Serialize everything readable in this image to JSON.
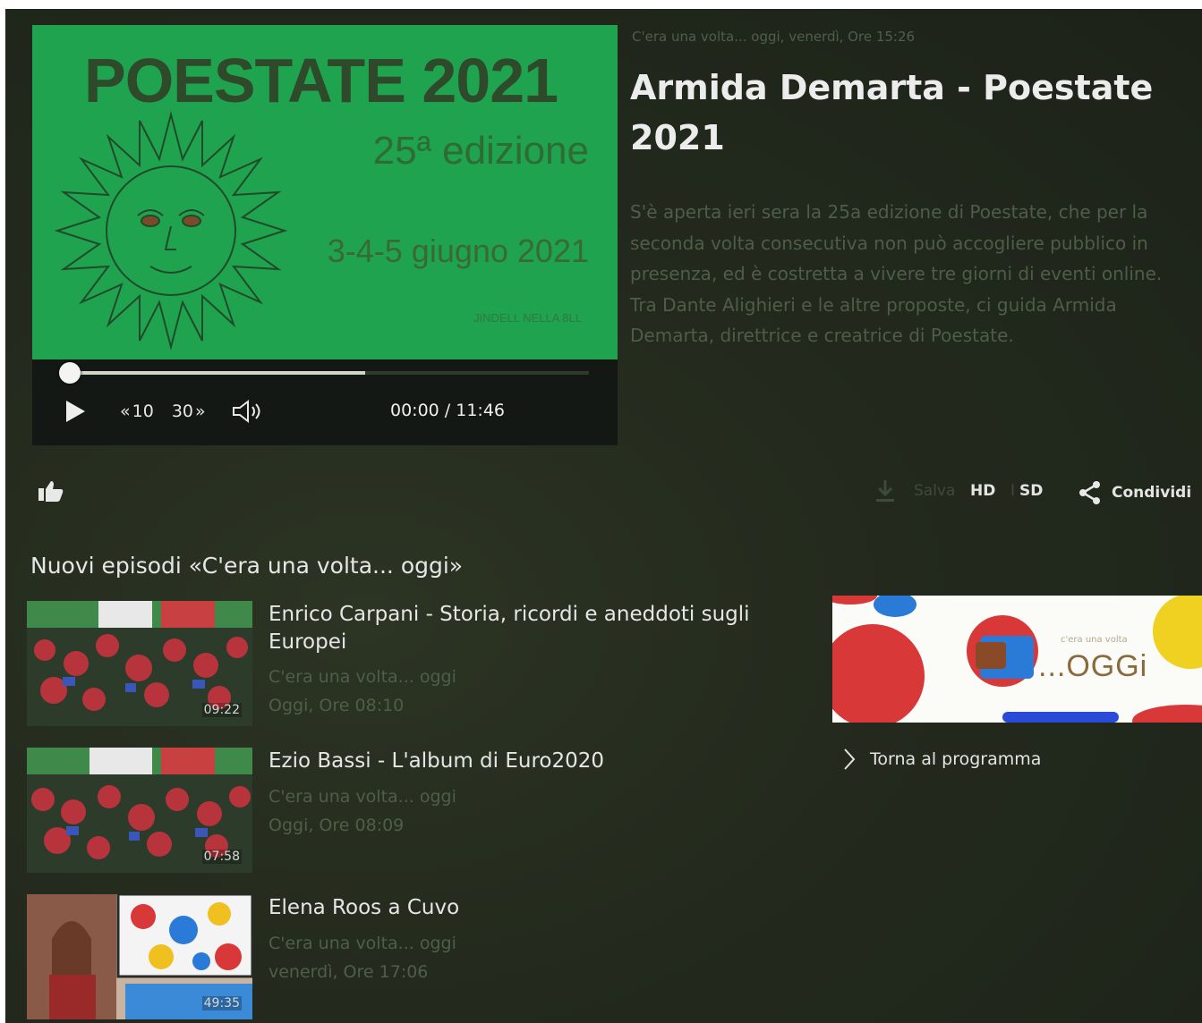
{
  "player": {
    "poster": {
      "title": "POESTATE 2021",
      "edition": "25ª edizione",
      "dates": "3-4-5 giugno 2021",
      "footer": "JINDELL NELLA 8LL"
    },
    "time": "00:00 / 11:46",
    "rewind_label": "10",
    "forward_label": "30",
    "progress": 0
  },
  "info": {
    "meta": "C'era una volta... oggi, venerdì, Ore 15:26",
    "title": "Armida Demarta - Poestate 2021",
    "description": "S'è aperta ieri sera la 25a edizione di Poestate, che per la seconda volta consecutiva non può accogliere pubblico in presenza, ed è costretta a vivere tre giorni di eventi online. Tra Dante Alighieri e le altre proposte, ci guida Armida Demarta, direttrice e creatrice di Poestate."
  },
  "actions": {
    "save_label": "Salva",
    "hd_label": "HD",
    "separator": "I",
    "sd_label": "SD",
    "share_label": "Condividi"
  },
  "episodes": {
    "section_title": "Nuovi episodi «C'era una volta... oggi»",
    "items": [
      {
        "title": "Enrico Carpani - Storia, ricordi e aneddoti sugli Europei",
        "show": "C'era una volta... oggi",
        "date": "Oggi, Ore 08:10",
        "duration": "09:22"
      },
      {
        "title": "Ezio Bassi - L'album di Euro2020",
        "show": "C'era una volta... oggi",
        "date": "Oggi, Ore 08:09",
        "duration": "07:58"
      },
      {
        "title": "Elena Roos a Cuvo",
        "show": "C'era una volta... oggi",
        "date": "venerdì, Ore 17:06",
        "duration": "49:35"
      }
    ]
  },
  "program": {
    "banner_logo": "...OGGi",
    "banner_small": "c'era una volta",
    "back_label": "Torna al programma"
  },
  "colors": {
    "background": "#232a1d",
    "poster_green": "#1fa34f",
    "text_main": "#e6e6e6",
    "text_muted": "#4f5e49"
  },
  "icons": [
    "sun-illustration",
    "play-icon",
    "rewind-10-icon",
    "forward-30-icon",
    "volume-icon",
    "thumbs-up-icon",
    "download-icon",
    "share-icon",
    "chevron-right-icon"
  ]
}
